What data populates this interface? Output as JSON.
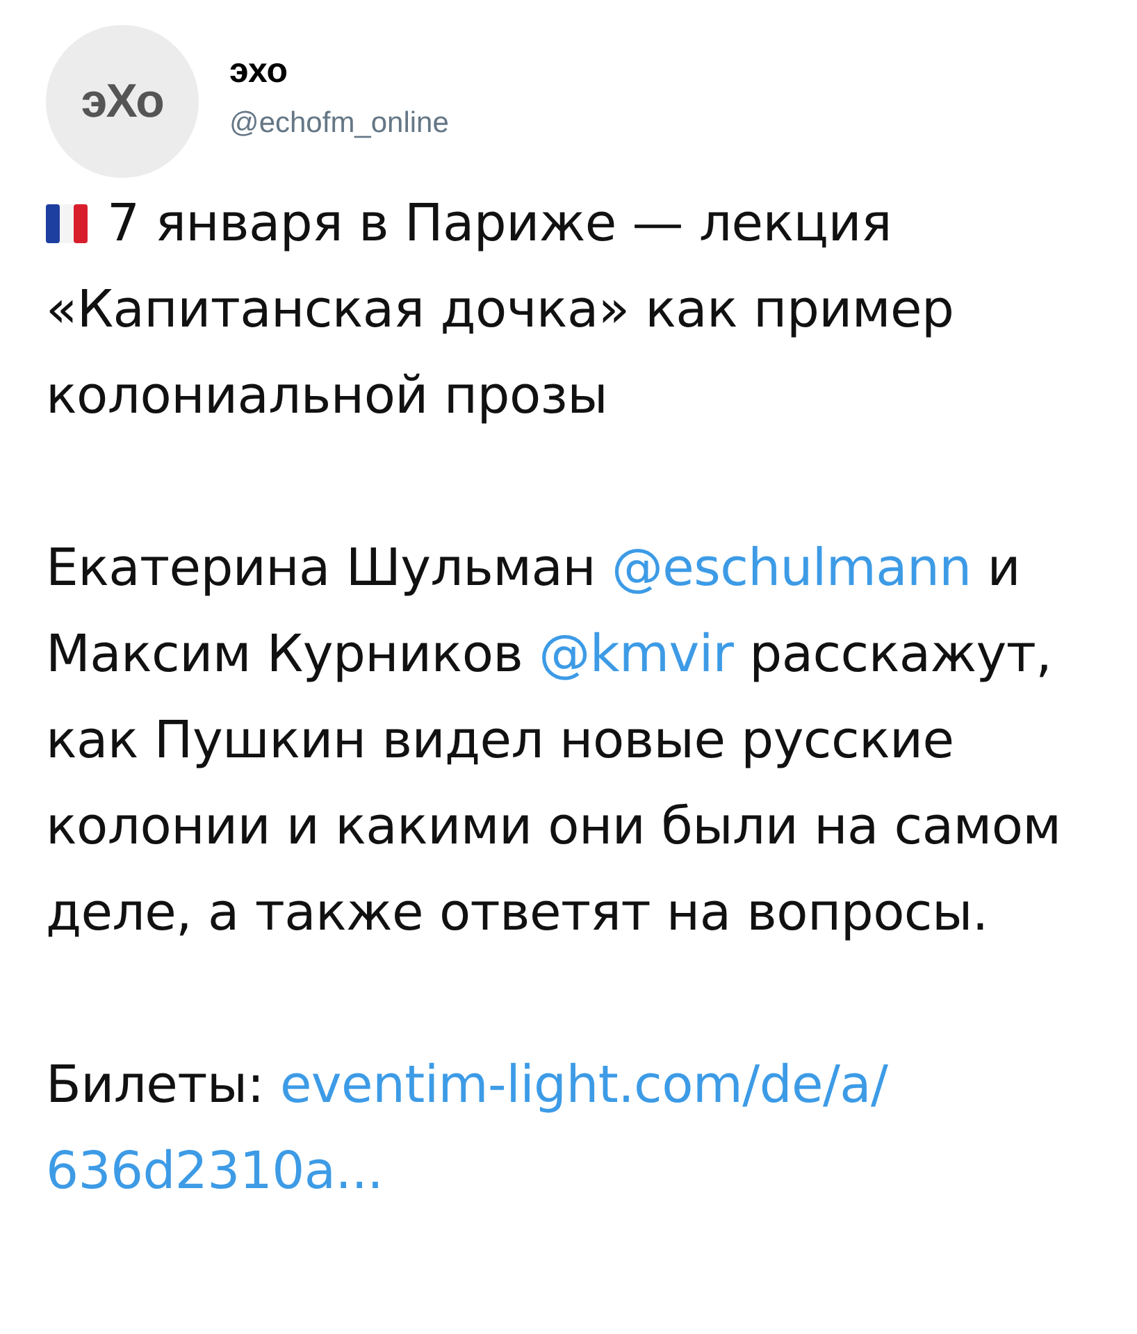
{
  "account": {
    "avatar_text": "эХо",
    "name": "эхо",
    "handle": "@echofm_online"
  },
  "paragraphs": [
    {
      "flag": true,
      "lead": "7 января в Париже — лекция",
      "segments": [
        {
          "kind": "text",
          "text": "«Капитанская дочка» как пример колониальной прозы"
        }
      ]
    },
    {
      "flag": false,
      "segments": [
        {
          "kind": "text",
          "text": "Екатерина Шульман "
        },
        {
          "kind": "mention",
          "text": "@eschulmann"
        },
        {
          "kind": "text",
          "text": " и Максим Курников "
        },
        {
          "kind": "mention",
          "text": "@kmvir"
        },
        {
          "kind": "text",
          "text": " расскажут, как Пушкин видел новые русские колонии и какими они были на самом деле, а также ответят на вопросы."
        }
      ]
    },
    {
      "flag": false,
      "segments": [
        {
          "kind": "text",
          "text": "Билеты: "
        },
        {
          "kind": "link",
          "text": "eventim-light.com/de/a/"
        },
        {
          "kind": "break"
        },
        {
          "kind": "link",
          "text": "636d2310a..."
        }
      ]
    }
  ]
}
